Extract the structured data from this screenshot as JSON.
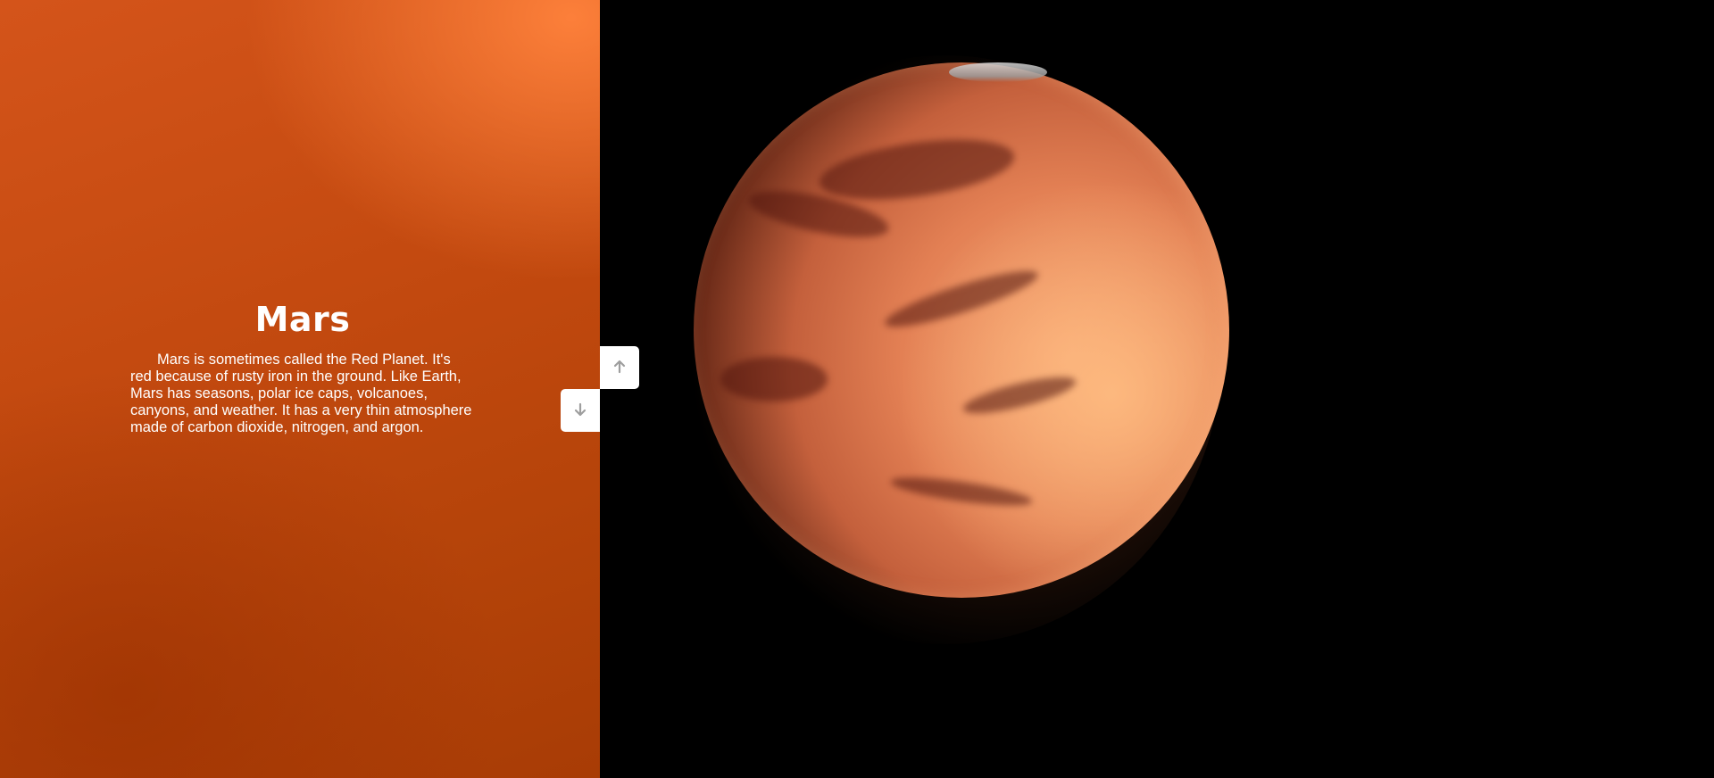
{
  "slide": {
    "title": "Mars",
    "description": "Mars is sometimes called the Red Planet. It's red because of rusty iron in the ground. Like Earth, Mars has seasons, polar ice caps, volcanoes, canyons, and weather. It has a very thin atmosphere made of carbon dioxide, nitrogen, and argon.",
    "background_color": "#c2490f",
    "text_color": "#ffffff"
  },
  "navigation": {
    "up_icon": "arrow-up-icon",
    "down_icon": "arrow-down-icon",
    "icon_color": "#9e9e9e"
  },
  "image": {
    "subject": "planet-mars",
    "background_color": "#000000"
  }
}
